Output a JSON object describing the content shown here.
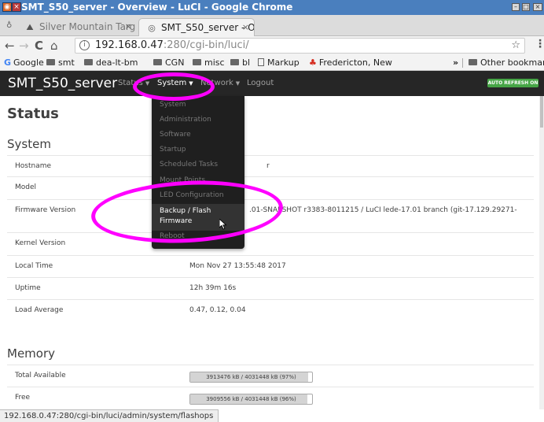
{
  "window": {
    "title": "SMT_S50_server - Overview - LuCI - Google Chrome",
    "app_icon": "chrome-icon",
    "controls": [
      "minimize",
      "maximize",
      "close"
    ]
  },
  "tabs": [
    {
      "label": "Silver Mountain Targ",
      "active": false,
      "icon": "mountain-icon"
    },
    {
      "label": "SMT_S50_server - O",
      "active": true,
      "icon": "openwrt-icon"
    }
  ],
  "toolbar": {
    "back": "←",
    "forward": "→",
    "reload": "C",
    "home": "⌂",
    "url_host": "192.168.0.47",
    "url_path": ":280/cgi-bin/luci/",
    "star": "☆",
    "menu": "⋮"
  },
  "bookmarks": {
    "items": [
      {
        "label": "Google",
        "icon": "google-icon"
      },
      {
        "label": "smt",
        "icon": "folder-icon"
      },
      {
        "label": "dea-lt-bm",
        "icon": "folder-icon"
      },
      {
        "label": "CGN",
        "icon": "folder-icon"
      },
      {
        "label": "misc",
        "icon": "folder-icon"
      },
      {
        "label": "bl",
        "icon": "folder-icon"
      },
      {
        "label": "Markup",
        "icon": "page-icon"
      },
      {
        "label": "Fredericton, New",
        "icon": "maple-leaf-icon"
      }
    ],
    "overflow": "»",
    "other": "Other bookmarks"
  },
  "header": {
    "brand": "SMT_S50_server",
    "nav": [
      {
        "label": "Status"
      },
      {
        "label": "System",
        "open": true
      },
      {
        "label": "Network"
      },
      {
        "label": "Logout"
      }
    ],
    "auto_refresh": "AUTO REFRESH ON"
  },
  "dropdown": {
    "items": [
      {
        "label": "System"
      },
      {
        "label": "Administration"
      },
      {
        "label": "Software"
      },
      {
        "label": "Startup"
      },
      {
        "label": "Scheduled Tasks"
      },
      {
        "label": "Mount Points"
      },
      {
        "label": "LED Configuration"
      },
      {
        "label": "Backup / Flash Firmware",
        "highlighted": true
      },
      {
        "label": "Reboot"
      }
    ]
  },
  "status": {
    "heading": "Status",
    "system_heading": "System",
    "rows": [
      {
        "label": "Hostname",
        "value": "r"
      },
      {
        "label": "Model",
        "value": ""
      },
      {
        "label": "Firmware Version",
        "value": ".01-SNAPSHOT r3383-8011215 / LuCI lede-17.01 branch (git-17.129.29271-"
      },
      {
        "label": "Kernel Version",
        "value": ""
      },
      {
        "label": "Local Time",
        "value": "Mon Nov 27 13:55:48 2017"
      },
      {
        "label": "Uptime",
        "value": "12h 39m 16s"
      },
      {
        "label": "Load Average",
        "value": "0.47, 0.12, 0.04"
      }
    ],
    "memory_heading": "Memory",
    "memory": [
      {
        "label": "Total Available",
        "text": "3913476 kB / 4031448 kB (97%)",
        "fraction": 0.97
      },
      {
        "label": "Free",
        "text": "3909556 kB / 4031448 kB (96%)",
        "fraction": 0.96
      }
    ]
  },
  "statusbar": {
    "url": "192.168.0.47:280/cgi-bin/luci/admin/system/flashops"
  },
  "colors": {
    "titlebar": "#4a7fbe",
    "header_bg": "#262626",
    "auto_refresh": "#46a546",
    "annotation": "#ff00ff",
    "dropdown_bg": "#1f1f1f"
  }
}
